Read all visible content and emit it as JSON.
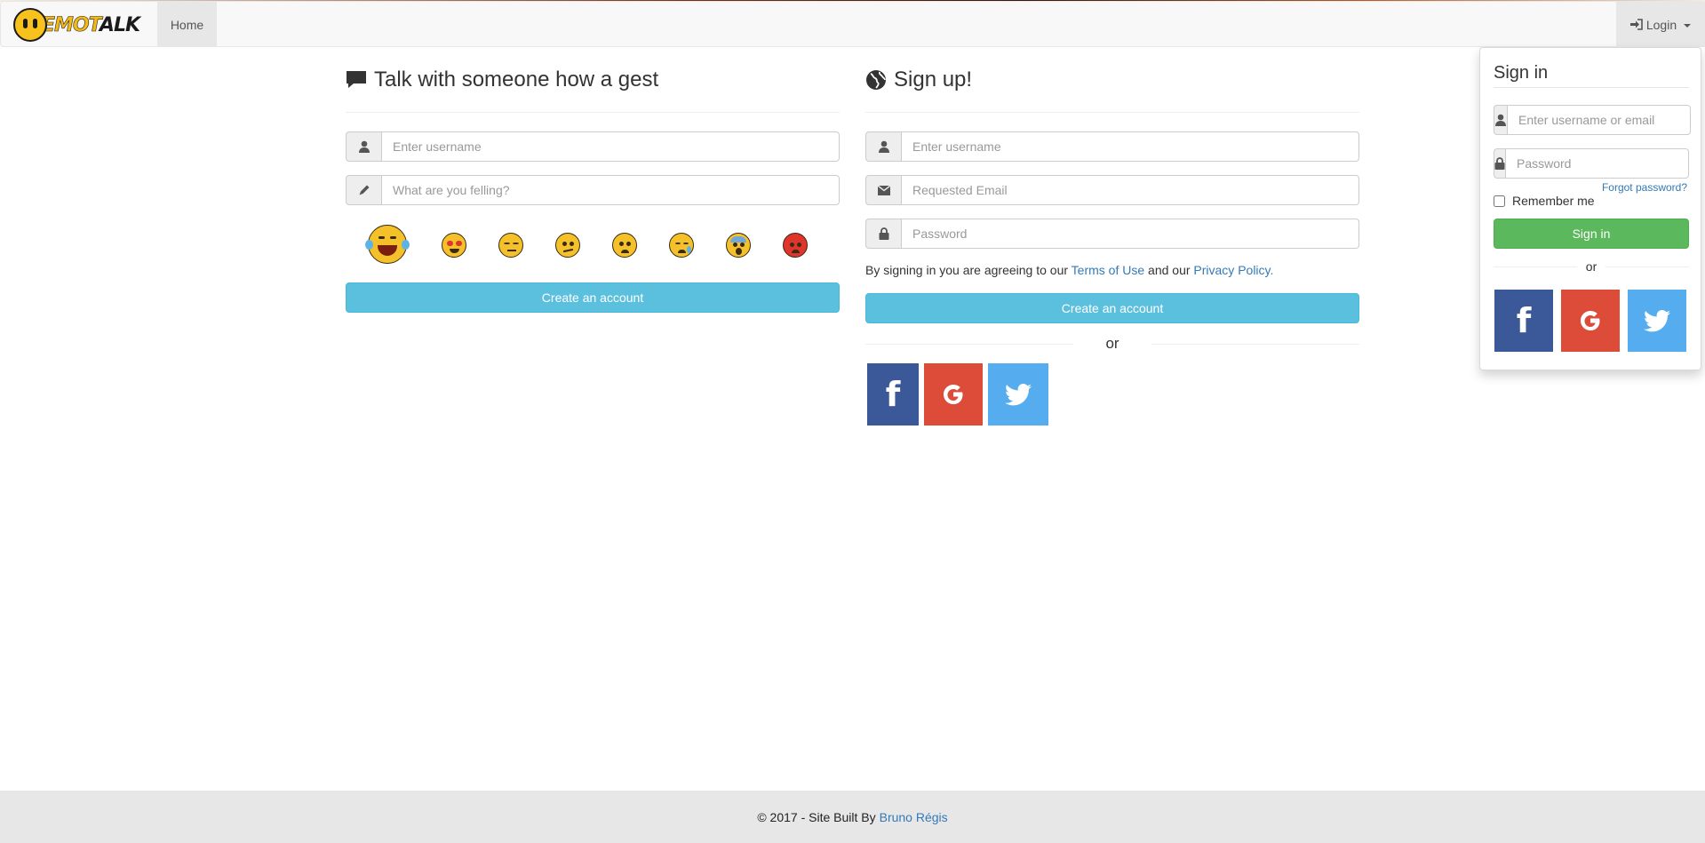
{
  "navbar": {
    "brand": {
      "part1": "EMOT",
      "part2": "ALK"
    },
    "home_label": "Home",
    "login_label": "Login"
  },
  "guest": {
    "title": "Talk with someone how a gest",
    "username_placeholder": "Enter username",
    "feeling_placeholder": "What are you felling?",
    "emojis": [
      "laughing-tears",
      "heart-eyes",
      "unamused",
      "confused",
      "worried",
      "sad-sweat",
      "fearful",
      "angry"
    ],
    "create_label": "Create an account"
  },
  "signup": {
    "title": "Sign up!",
    "username_placeholder": "Enter username",
    "email_placeholder": "Requested Email",
    "password_placeholder": "Password",
    "terms_prefix": "By signing in you are agreeing to our ",
    "terms_link": "Terms of Use",
    "terms_middle": " and our ",
    "privacy_link": "Privacy Policy",
    "terms_suffix": ".",
    "create_label": "Create an account",
    "or_label": "or"
  },
  "signin": {
    "title": "Sign in",
    "username_placeholder": "Enter username or email",
    "password_placeholder": "Password",
    "forgot_label": "Forgot password?",
    "remember_label": "Remember me",
    "submit_label": "Sign in",
    "or_label": "or"
  },
  "footer": {
    "text": "© 2017 - Site Built By ",
    "author": "Bruno Régis"
  },
  "colors": {
    "facebook": "#3b5998",
    "google": "#dd4b39",
    "twitter": "#55acee",
    "info": "#5bc0de",
    "success": "#5cb85c",
    "link": "#337ab7"
  }
}
